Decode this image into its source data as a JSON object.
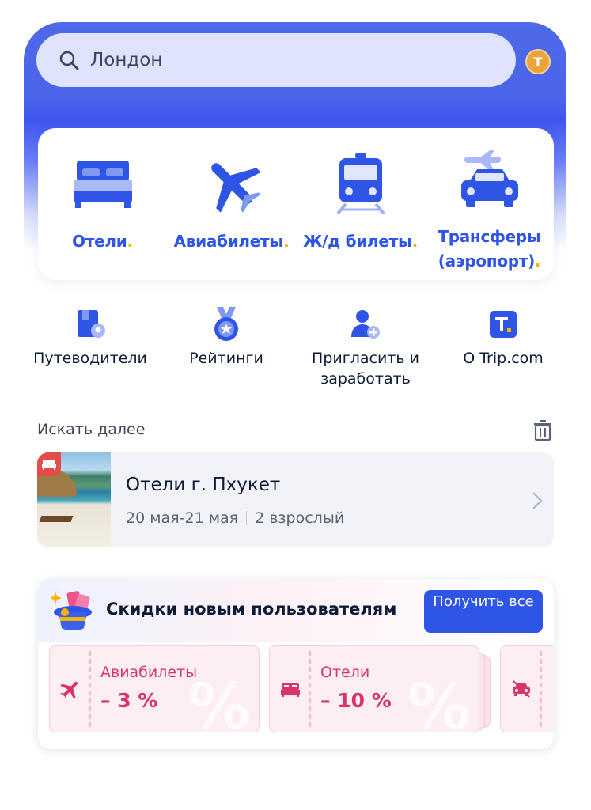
{
  "search": {
    "value": "Лондон",
    "icon": "search-icon"
  },
  "avatar": {
    "letter": "T"
  },
  "categories": [
    {
      "label": "Отели",
      "icon": "bed-icon"
    },
    {
      "label": "Авиабилеты",
      "icon": "airplane-icon"
    },
    {
      "label": "Ж/д билеты",
      "icon": "train-icon"
    },
    {
      "label_line1": "Трансферы",
      "label_line2": "(аэропорт)",
      "icon": "airport-transfer-icon"
    }
  ],
  "subcategories": [
    {
      "label": "Путеводители",
      "icon": "guidebook-icon"
    },
    {
      "label": "Рейтинги",
      "icon": "medal-icon"
    },
    {
      "label_line1": "Пригласить и",
      "label_line2": "заработать",
      "icon": "invite-user-icon"
    },
    {
      "label": "О Trip.com",
      "icon": "trip-logo-icon"
    }
  ],
  "recent": {
    "title": "Искать далее",
    "item": {
      "title": "Отели г. Пхукет",
      "dates": "20 мая-21 мая",
      "guests": "2 взрослый"
    }
  },
  "promo": {
    "title": "Скидки новым пользователям",
    "button": "Получить все",
    "coupons": [
      {
        "label": "Авиабилеты",
        "value": "– 3 %",
        "icon": "airplane-icon"
      },
      {
        "label": "Отели",
        "value": "– 10 %",
        "icon": "bed-icon"
      },
      {
        "label": "",
        "value": "",
        "icon": "car-icon"
      }
    ]
  },
  "colors": {
    "brand_blue": "#2f55e6",
    "accent_yellow": "#f5b400",
    "coupon_pink": "#d9336f"
  }
}
